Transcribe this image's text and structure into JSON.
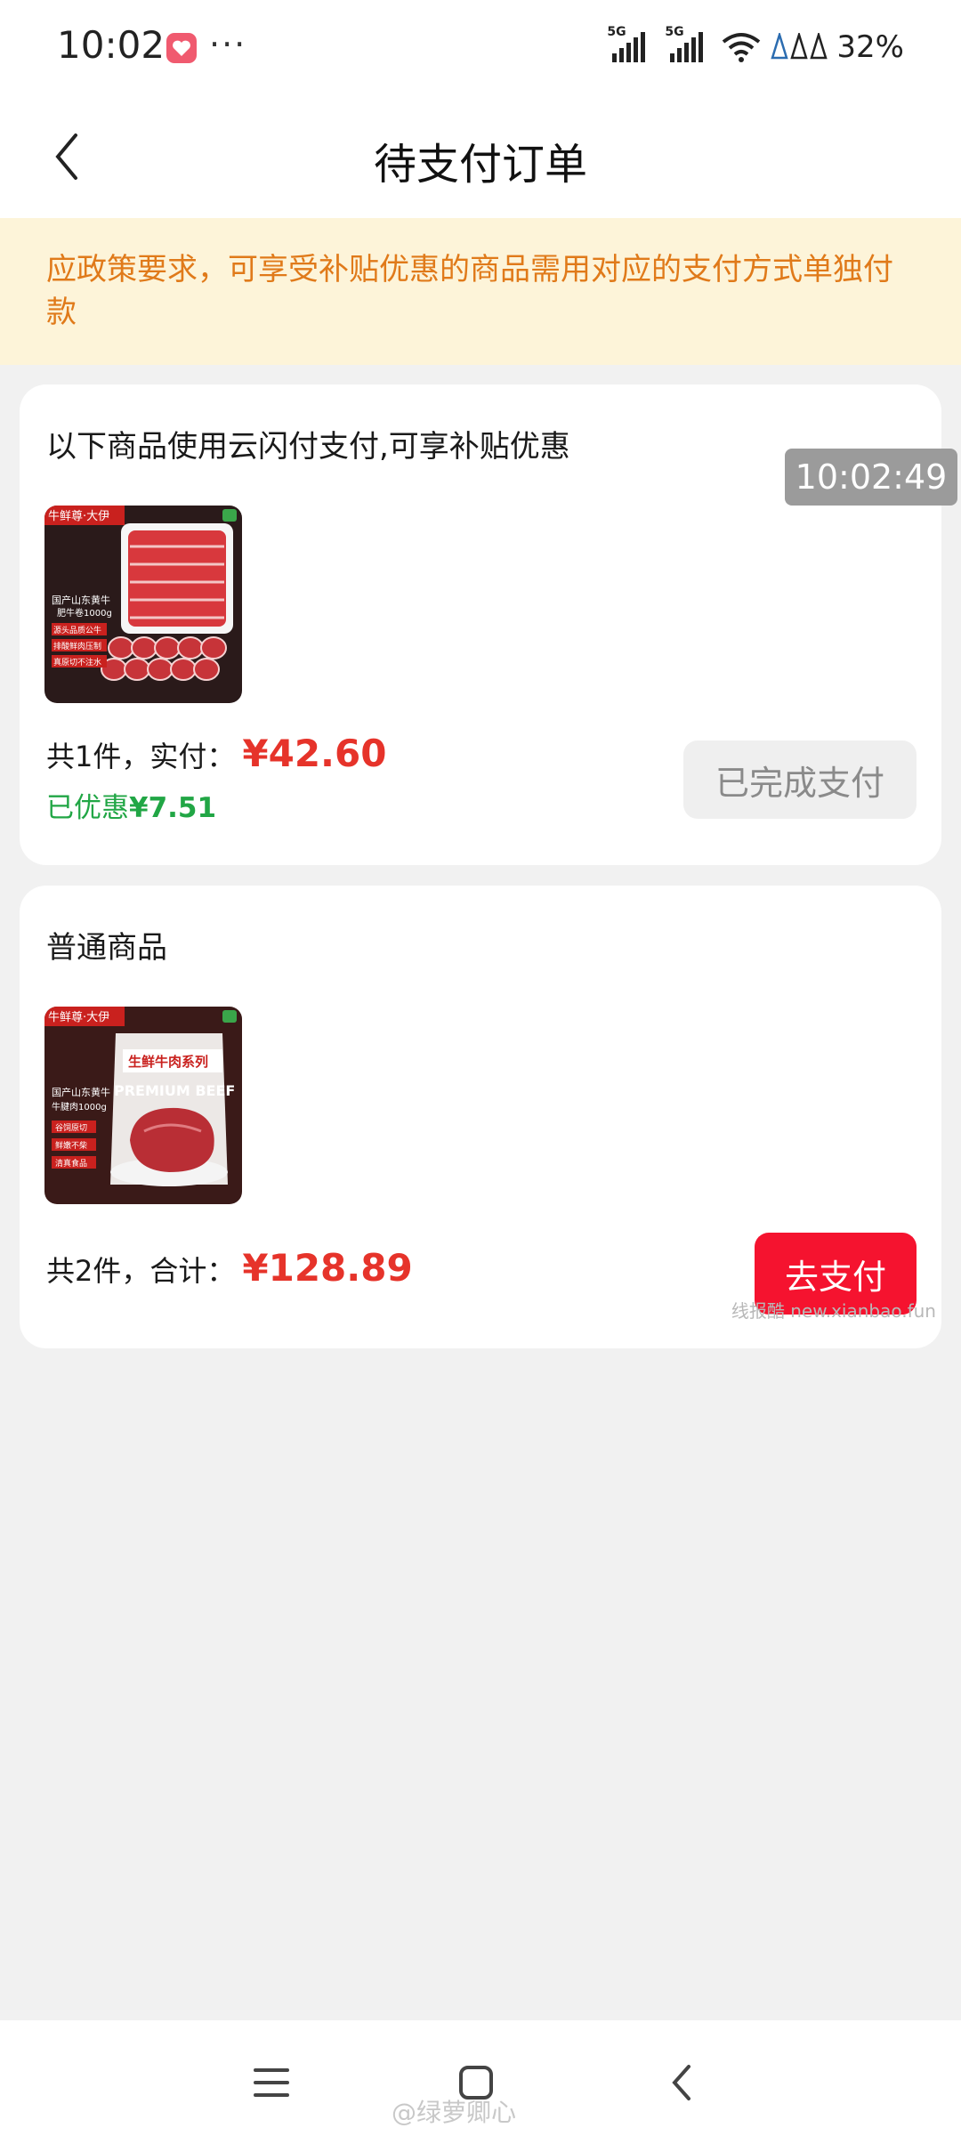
{
  "status_bar": {
    "time": "10:02",
    "more": "···",
    "network_1": "5G",
    "network_2": "5G",
    "battery": "32%"
  },
  "header": {
    "title": "待支付订单"
  },
  "notice": {
    "text": "应政策要求，可享受补贴优惠的商品需用对应的支付方式单独付款"
  },
  "orders": [
    {
      "title": "以下商品使用云闪付支付,可享补贴优惠",
      "count_label": "共1件，实付：",
      "amount": "¥42.60",
      "saved_label": "已优惠",
      "saved_amount": "¥7.51",
      "action": "已完成支付",
      "thumb_brand": "牛鲜尊·大伊",
      "thumb_lines": [
        "国产山东黄牛",
        "肥牛卷1000g",
        "源头品质公牛",
        "排酸鲜肉压制",
        "真原切不注水"
      ]
    },
    {
      "title": "普通商品",
      "count_label": "共2件，合计：",
      "amount": "¥128.89",
      "action": "去支付",
      "thumb_brand": "牛鲜尊·大伊",
      "thumb_bag": "生鲜牛肉系列",
      "thumb_bag_en": "PREMIUM BEEF",
      "thumb_lines": [
        "国产山东黄牛",
        "牛腱肉1000g",
        "谷饲原切",
        "鲜嫩不柴",
        "清真食品"
      ]
    }
  ],
  "overlays": {
    "timestamp": "10:02:49",
    "site_watermark": "线报酷 new.xianbao.fun",
    "weibo_watermark": "@绿萝卿心"
  }
}
